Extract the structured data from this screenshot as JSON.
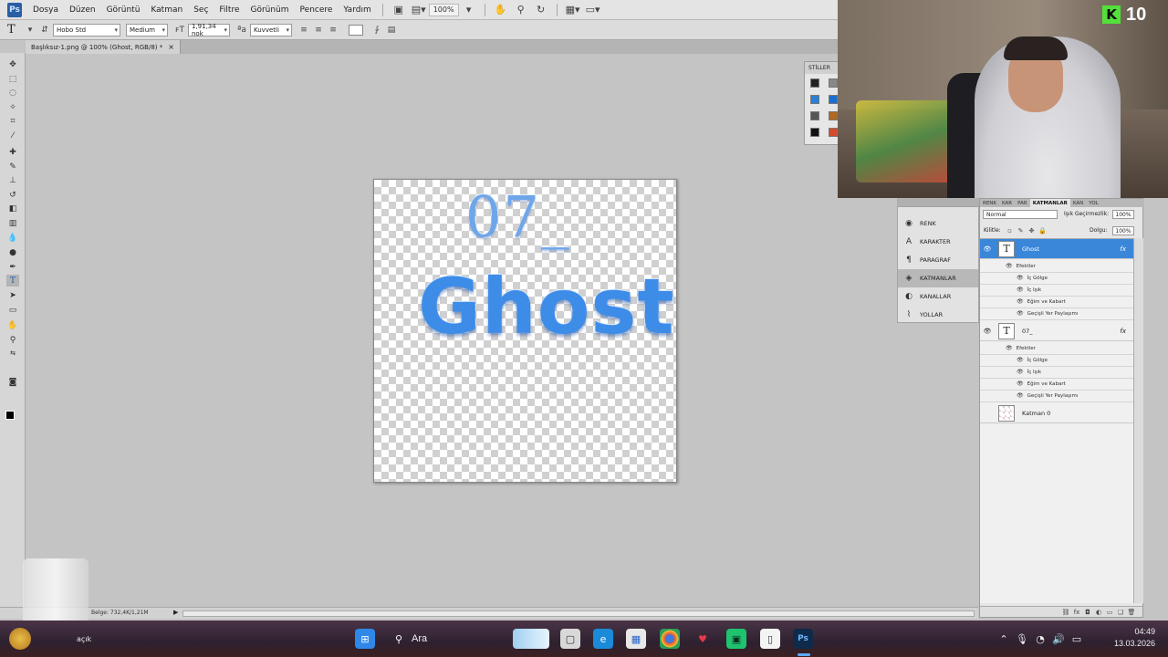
{
  "app": {
    "logo": "Ps",
    "menu": [
      "Dosya",
      "Düzen",
      "Görüntü",
      "Katman",
      "Seç",
      "Filtre",
      "Görünüm",
      "Pencere",
      "Yardım"
    ],
    "zoom_menu": "100%"
  },
  "options_bar": {
    "tool_glyph": "T",
    "font_family": "Hobo Std",
    "font_style": "Medium",
    "font_size": "1,91,34 nok",
    "antialias": "Kuvvetli"
  },
  "document": {
    "tab_title": "Başlıksız-1.png @ 100% (Ghost, RGB/8) *",
    "close": "×",
    "canvas_text_top": "07_",
    "canvas_text_main": "Ghost"
  },
  "status": {
    "doc_info": "Belge: 732,4K/1,21M",
    "arrow": "▶"
  },
  "styles_panel": {
    "tab": "STİLLER"
  },
  "dock": {
    "items": [
      {
        "label": "RENK",
        "icon": "◉"
      },
      {
        "label": "KARAKTER",
        "icon": "A"
      },
      {
        "label": "PARAGRAF",
        "icon": "¶"
      },
      {
        "label": "KATMANLAR",
        "icon": "◈"
      },
      {
        "label": "KANALLAR",
        "icon": "◐"
      },
      {
        "label": "YOLLAR",
        "icon": "⌇"
      }
    ]
  },
  "layers": {
    "tabs": [
      "RENK",
      "KAR",
      "PAR",
      "KATMANLAR",
      "KAN",
      "YOL"
    ],
    "blend_mode": "Normal",
    "opacity_label": "Işık Geçirmezlik:",
    "opacity_value": "100%",
    "lock_label": "Kilitle:",
    "fill_label": "Dolgu:",
    "fill_value": "100%",
    "items": [
      {
        "name": "Ghost",
        "thumb": "T",
        "fx": "fx",
        "selected": true
      },
      {
        "name": "07_",
        "thumb": "T",
        "fx": "fx",
        "selected": false
      },
      {
        "name": "Katman 0",
        "thumb": "",
        "fx": "",
        "selected": false
      }
    ],
    "effects_label": "Efektler",
    "effects": [
      "İç Gölge",
      "İç Işık",
      "Eğim ve Kabart",
      "Geçişli Yer Paylaşımı"
    ]
  },
  "webcam": {
    "badge_logo": "K",
    "badge_count": "10"
  },
  "taskbar": {
    "weather_text": "açık",
    "search_label": "Ara",
    "time": "04:49",
    "date": "13.03.2026"
  },
  "colors": {
    "accent_selection": "#3a86d8",
    "canvas_text_blue": "#3d8ce8",
    "kick_green": "#53e03a"
  }
}
